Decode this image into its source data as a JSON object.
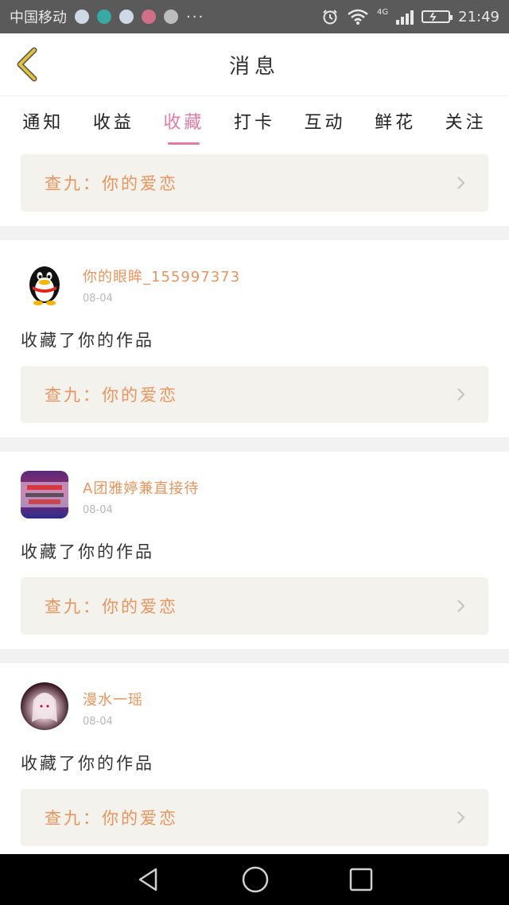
{
  "status_bar": {
    "carrier": "中国移动",
    "more": "···",
    "network": "4G",
    "time": "21:49"
  },
  "header": {
    "title": "消息"
  },
  "tabs": [
    {
      "label": "通知"
    },
    {
      "label": "收益"
    },
    {
      "label": "收藏",
      "active": true
    },
    {
      "label": "打卡"
    },
    {
      "label": "互动"
    },
    {
      "label": "鲜花"
    },
    {
      "label": "关注"
    }
  ],
  "items": [
    {
      "work": "查九：你的爱恋"
    },
    {
      "username": "你的眼眸_155997373",
      "date": "08-04",
      "action": "收藏了你的作品",
      "work": "查九：你的爱恋"
    },
    {
      "username": "A团雅婷兼直接待",
      "date": "08-04",
      "action": "收藏了你的作品",
      "work": "查九：你的爱恋"
    },
    {
      "username": "漫水一瑶",
      "date": "08-04",
      "action": "收藏了你的作品",
      "work": "查九：你的爱恋"
    }
  ],
  "colors": {
    "accent_pink": "#e47aa4",
    "orange_text": "#e8945e",
    "box_bg": "#f3f2ec",
    "back_arrow": "#e3c23a"
  }
}
